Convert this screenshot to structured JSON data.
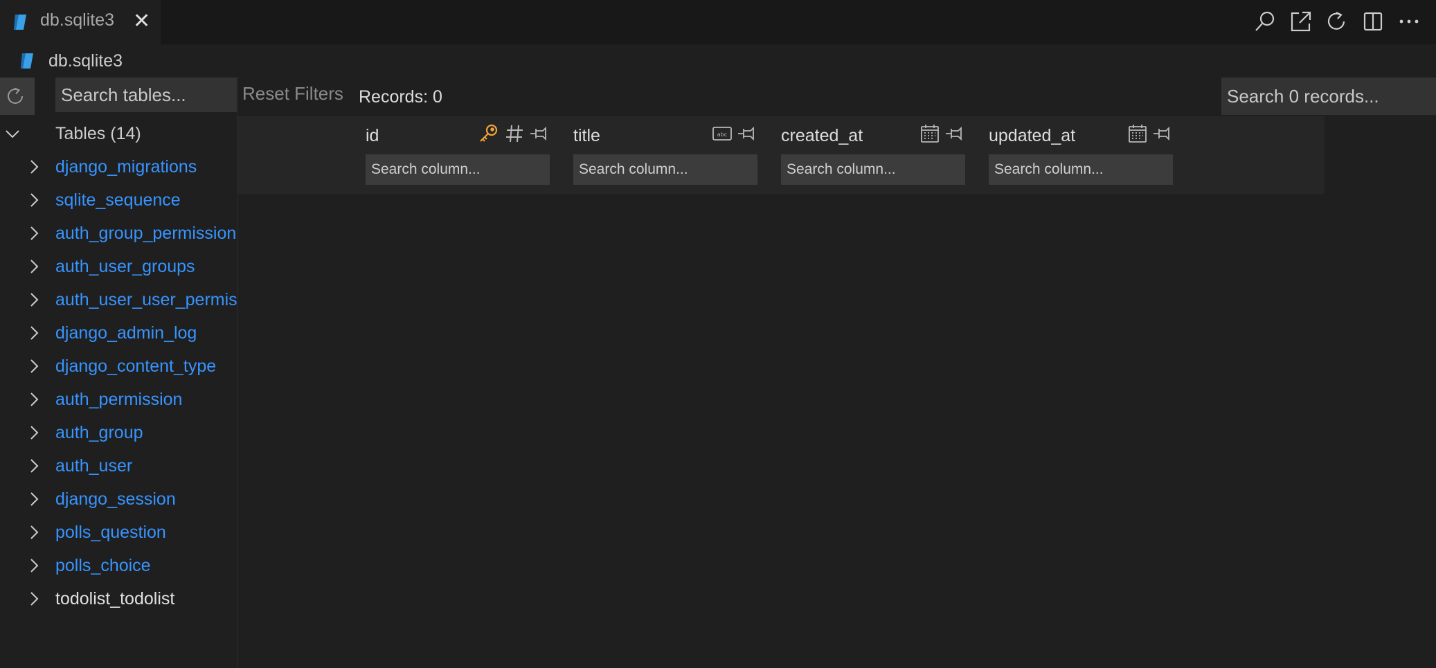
{
  "tab": {
    "label": "db.sqlite3",
    "close": "✕"
  },
  "breadcrumb": {
    "label": "db.sqlite3"
  },
  "sidebar": {
    "search_placeholder": "Search tables...",
    "tables_header": "Tables (14)",
    "tables": [
      "django_migrations",
      "sqlite_sequence",
      "auth_group_permissions",
      "auth_user_groups",
      "auth_user_user_permissions",
      "django_admin_log",
      "django_content_type",
      "auth_permission",
      "auth_group",
      "auth_user",
      "django_session",
      "polls_question",
      "polls_choice",
      "todolist_todolist"
    ]
  },
  "toolbar": {
    "reset_filters": "Reset Filters",
    "records": "Records: 0",
    "search_records_placeholder": "Search 0 records..."
  },
  "columns": [
    {
      "name": "id",
      "placeholder": "Search column..."
    },
    {
      "name": "title",
      "placeholder": "Search column..."
    },
    {
      "name": "created_at",
      "placeholder": "Search column..."
    },
    {
      "name": "updated_at",
      "placeholder": "Search column..."
    }
  ],
  "colors": {
    "link": "#3794ff",
    "key_icon": "#f0a43a",
    "file_icon": "#3aa0e8"
  }
}
